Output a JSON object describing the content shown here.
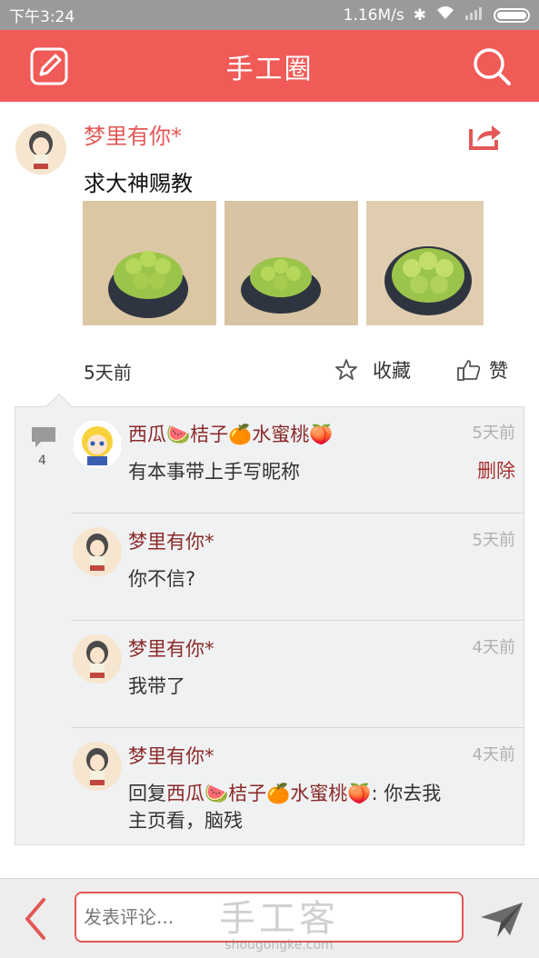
{
  "status_bar": {
    "time": "下午3:24",
    "network_speed": "1.16M/s"
  },
  "header": {
    "title": "手工圈"
  },
  "post": {
    "author": "梦里有你*",
    "content": "求大神赐教",
    "time": "5天前",
    "favorite_label": "收藏",
    "like_label": "赞"
  },
  "comments": {
    "count": "4",
    "items": [
      {
        "author": "西瓜🍉桔子🍊水蜜桃🍑",
        "time": "5天前",
        "text": "有本事带上手写昵称",
        "delete_label": "删除"
      },
      {
        "author": "梦里有你*",
        "time": "5天前",
        "text": "你不信?"
      },
      {
        "author": "梦里有你*",
        "time": "4天前",
        "text": "我带了"
      },
      {
        "author": "梦里有你*",
        "time": "4天前",
        "reply_prefix": "回复",
        "reply_to": "西瓜🍉桔子🍊水蜜桃🍑",
        "text": ": 你去我主页看，脑残"
      }
    ]
  },
  "composer": {
    "placeholder": "发表评论..."
  },
  "watermark": {
    "main": "手工客",
    "sub": "shougongke.com"
  },
  "colors": {
    "accent": "#f05a57",
    "author_link": "#8b2a2a",
    "panel_bg": "#f0f1f2"
  }
}
